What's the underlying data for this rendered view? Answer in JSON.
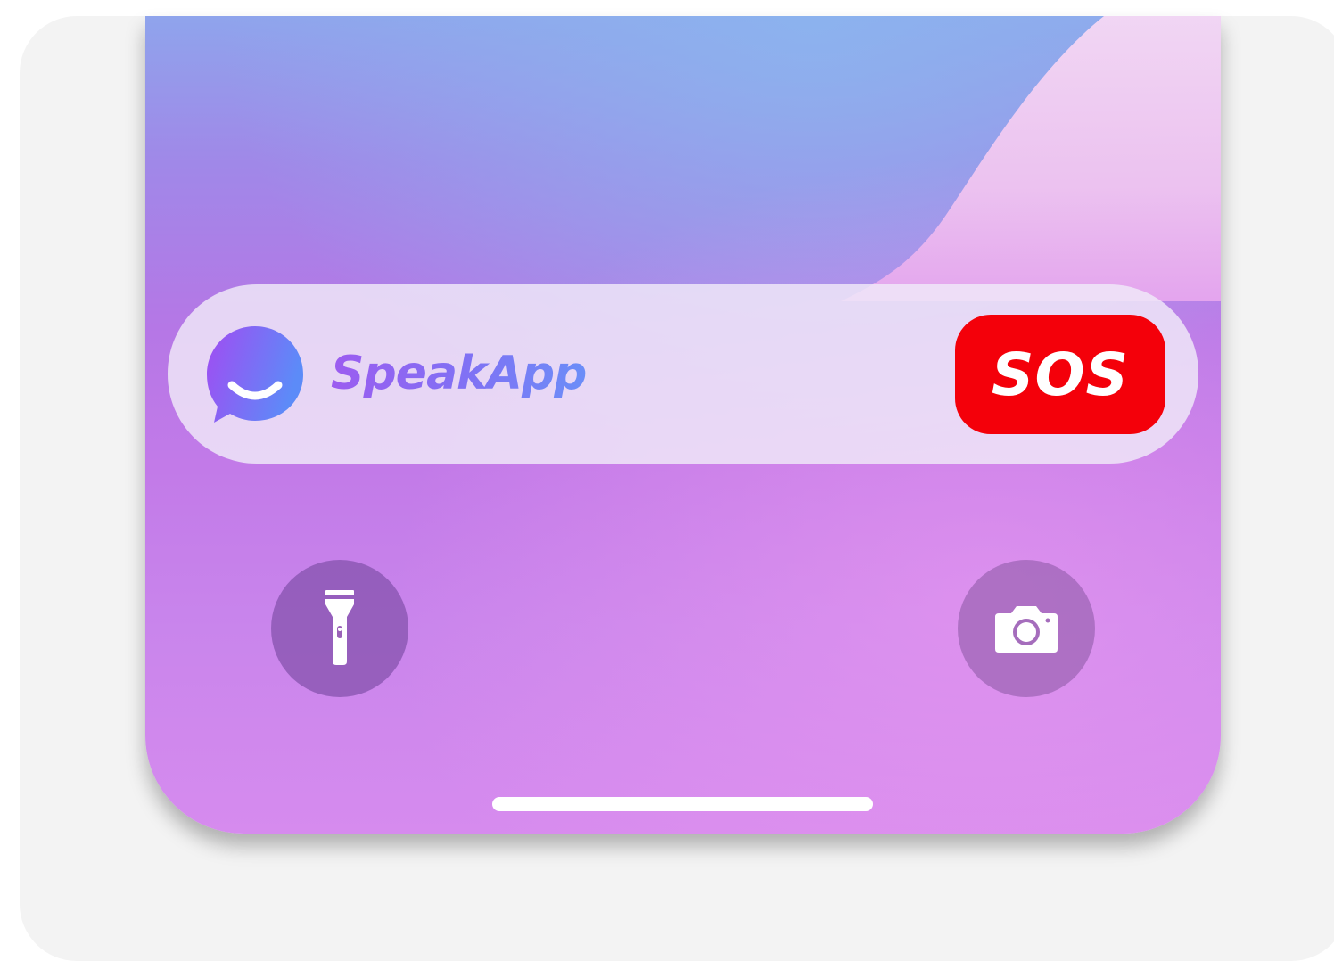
{
  "widget": {
    "app_name": "SpeakApp",
    "sos_label": "SOS"
  },
  "quick_actions": {
    "left_icon": "flashlight-icon",
    "right_icon": "camera-icon"
  },
  "colors": {
    "sos_red": "#f4000a",
    "brand_purple": "#9c5cf0",
    "brand_blue": "#6b8ef8"
  }
}
